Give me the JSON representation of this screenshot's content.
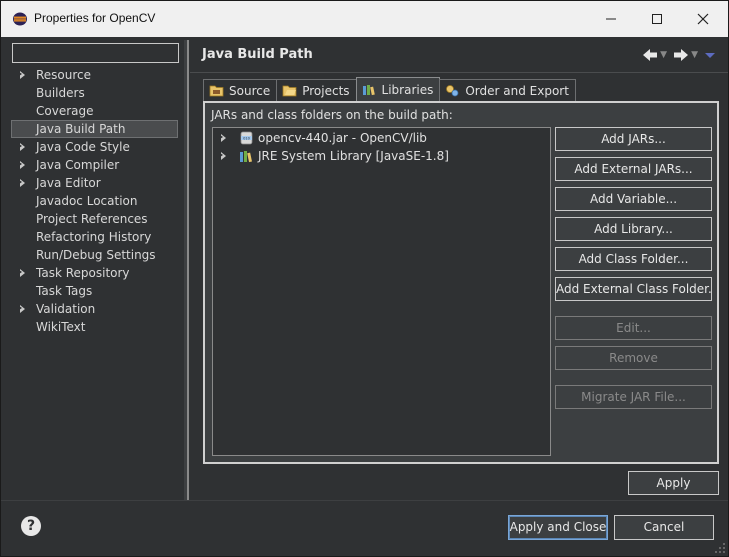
{
  "window": {
    "title": "Properties for OpenCV"
  },
  "filter": {
    "value": ""
  },
  "tree": {
    "items": [
      {
        "label": "Resource",
        "expandable": true
      },
      {
        "label": "Builders",
        "expandable": false
      },
      {
        "label": "Coverage",
        "expandable": false
      },
      {
        "label": "Java Build Path",
        "expandable": false,
        "selected": true
      },
      {
        "label": "Java Code Style",
        "expandable": true
      },
      {
        "label": "Java Compiler",
        "expandable": true
      },
      {
        "label": "Java Editor",
        "expandable": true
      },
      {
        "label": "Javadoc Location",
        "expandable": false
      },
      {
        "label": "Project References",
        "expandable": false
      },
      {
        "label": "Refactoring History",
        "expandable": false
      },
      {
        "label": "Run/Debug Settings",
        "expandable": false
      },
      {
        "label": "Task Repository",
        "expandable": true
      },
      {
        "label": "Task Tags",
        "expandable": false
      },
      {
        "label": "Validation",
        "expandable": true
      },
      {
        "label": "WikiText",
        "expandable": false
      }
    ]
  },
  "page": {
    "title": "Java Build Path"
  },
  "tabs": [
    {
      "label": "Source",
      "icon": "source-folder-icon"
    },
    {
      "label": "Projects",
      "icon": "projects-folder-icon"
    },
    {
      "label": "Libraries",
      "icon": "libraries-icon",
      "active": true
    },
    {
      "label": "Order and Export",
      "icon": "order-export-icon"
    }
  ],
  "libraries": {
    "label": "JARs and class folders on the build path:",
    "entries": [
      {
        "label": "opencv-440.jar - OpenCV/lib",
        "icon": "jar-icon"
      },
      {
        "label": "JRE System Library [JavaSE-1.8]",
        "icon": "library-icon"
      }
    ]
  },
  "buttons": {
    "add_jars": "Add JARs...",
    "add_external_jars": "Add External JARs...",
    "add_variable": "Add Variable...",
    "add_library": "Add Library...",
    "add_class_folder": "Add Class Folder...",
    "add_external_class_folder": "Add External Class Folder...",
    "edit": "Edit...",
    "remove": "Remove",
    "migrate_jar": "Migrate JAR File..."
  },
  "apply": "Apply",
  "footer": {
    "apply_close": "Apply and Close",
    "cancel": "Cancel",
    "help": "?"
  },
  "colors": {
    "background": "#2f3133",
    "panel": "#3c3f41",
    "border": "#c8c8c8",
    "accent": "#7aa6d6"
  }
}
